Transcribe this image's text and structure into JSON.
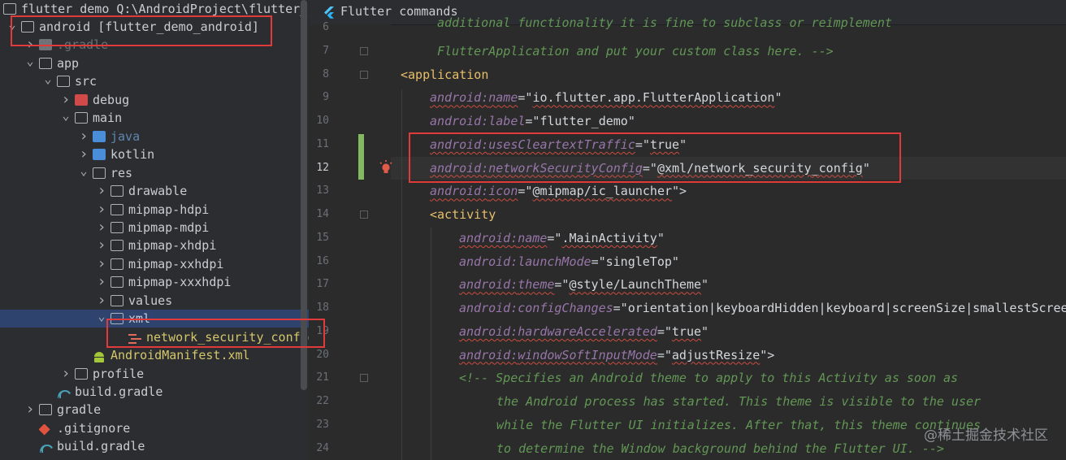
{
  "tree": {
    "header": "flutter_demo  Q:\\AndroidProject\\flutter_",
    "items": [
      {
        "label": "android [flutter_demo_android]",
        "depth": 0,
        "icon": "folder-icon"
      },
      {
        "label": ".gradle",
        "depth": 1,
        "icon": "folder-icon"
      },
      {
        "label": "app",
        "depth": 1,
        "icon": "folder-icon"
      },
      {
        "label": "src",
        "depth": 2,
        "icon": "folder-icon"
      },
      {
        "label": "debug",
        "depth": 3,
        "icon": "folder-icon"
      },
      {
        "label": "main",
        "depth": 3,
        "icon": "folder-icon"
      },
      {
        "label": "java",
        "depth": 4,
        "icon": "folder-icon"
      },
      {
        "label": "kotlin",
        "depth": 4,
        "icon": "folder-icon"
      },
      {
        "label": "res",
        "depth": 4,
        "icon": "folder-icon"
      },
      {
        "label": "drawable",
        "depth": 5,
        "icon": "folder-icon"
      },
      {
        "label": "mipmap-hdpi",
        "depth": 5,
        "icon": "folder-icon"
      },
      {
        "label": "mipmap-mdpi",
        "depth": 5,
        "icon": "folder-icon"
      },
      {
        "label": "mipmap-xhdpi",
        "depth": 5,
        "icon": "folder-icon"
      },
      {
        "label": "mipmap-xxhdpi",
        "depth": 5,
        "icon": "folder-icon"
      },
      {
        "label": "mipmap-xxxhdpi",
        "depth": 5,
        "icon": "folder-icon"
      },
      {
        "label": "values",
        "depth": 5,
        "icon": "folder-icon"
      },
      {
        "label": "xml",
        "depth": 5,
        "icon": "folder-icon"
      },
      {
        "label": "network_security_config",
        "depth": 6,
        "icon": "xml-file-icon"
      },
      {
        "label": "AndroidManifest.xml",
        "depth": 4,
        "icon": "android-icon"
      },
      {
        "label": "profile",
        "depth": 3,
        "icon": "folder-icon"
      },
      {
        "label": "build.gradle",
        "depth": 2,
        "icon": "gradle-icon"
      },
      {
        "label": "gradle",
        "depth": 1,
        "icon": "folder-icon"
      },
      {
        "label": ".gitignore",
        "depth": 1,
        "icon": "git-icon"
      },
      {
        "label": "build.gradle",
        "depth": 1,
        "icon": "gradle-icon"
      }
    ]
  },
  "editor": {
    "tab_title": "Flutter commands",
    "line_numbers": [
      "6",
      "7",
      "8",
      "9",
      "10",
      "11",
      "12",
      "13",
      "14",
      "15",
      "16",
      "17",
      "18",
      "19",
      "20",
      "21",
      "22",
      "23",
      "24"
    ],
    "lines": {
      "l6": "additional functionality it is fine to subclass or reimplement",
      "l7": "FlutterApplication and put your custom class here. -->",
      "l8_tag": "<application",
      "l9_ns": "android:",
      "l9_attr": "name",
      "l9_val": "io.flutter.app.FlutterApplication",
      "l10_ns": "android:",
      "l10_attr": "label",
      "l10_val": "flutter_demo",
      "l11_ns": "android:",
      "l11_attr": "usesCleartextTraffic",
      "l11_val": "true",
      "l12_ns": "android:",
      "l12_attr": "networkSecurityConfig",
      "l12_val": "@xml/network_security_config",
      "l13_ns": "android:",
      "l13_attr": "icon",
      "l13_val": "@mipmap/ic_launcher",
      "l14_tag": "<activity",
      "l15_ns": "android:",
      "l15_attr": "name",
      "l15_val": ".MainActivity",
      "l16_ns": "android:",
      "l16_attr": "launchMode",
      "l16_val": "singleTop",
      "l17_ns": "android:",
      "l17_attr": "theme",
      "l17_val": "@style/LaunchTheme",
      "l18_ns": "android:",
      "l18_attr": "configChanges",
      "l18_val": "orientation|keyboardHidden|keyboard|screenSize|smallestScree",
      "l19_ns": "android:",
      "l19_attr": "hardwareAccelerated",
      "l19_val": "true",
      "l20_ns": "android:",
      "l20_attr": "windowSoftInputMode",
      "l20_val": "adjustResize",
      "l21": "<!-- Specifies an Android theme to apply to this Activity as soon as",
      "l22": "the Android process has started. This theme is visible to the user",
      "l23": "while the Flutter UI initializes. After that, this theme continues",
      "l24": "to determine the Window background behind the Flutter UI. -->"
    }
  },
  "watermark": "@稀土掘金技术社区",
  "colors": {
    "highlight_box": "#e03a3a",
    "change_marker": "#84b961"
  }
}
